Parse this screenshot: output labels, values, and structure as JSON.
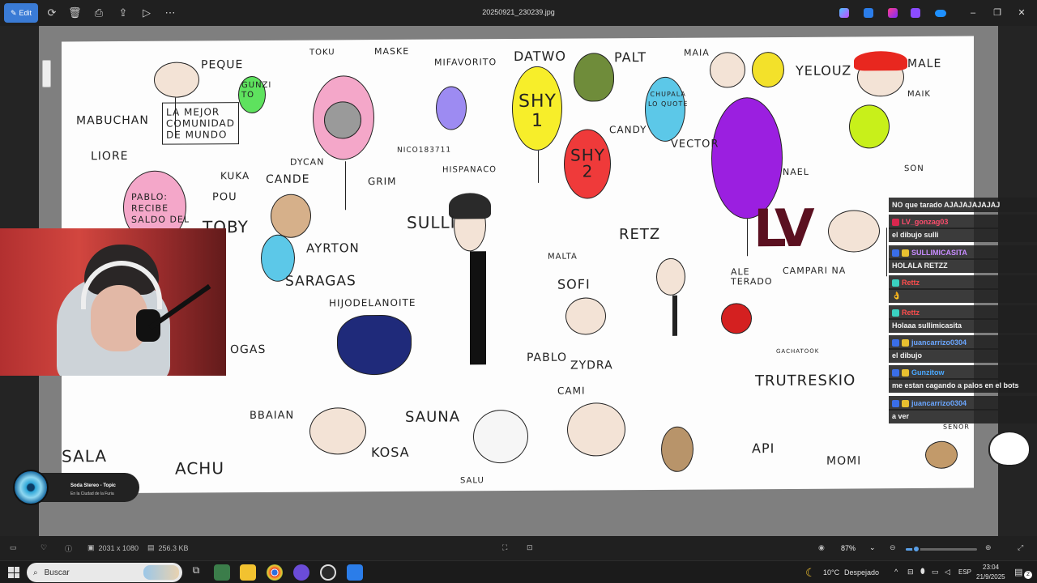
{
  "titlebar": {
    "edit_label": "Edit",
    "file_name": "20250921_230239.jpg",
    "icons": [
      "edit-icon",
      "rotate-icon",
      "delete-icon",
      "print-icon",
      "share-icon",
      "slideshow-icon",
      "more-icon"
    ],
    "window_controls": [
      "minimize-icon",
      "restore-icon",
      "close-icon"
    ]
  },
  "canvas_labels": {
    "mabuchan": "MABUCHAN",
    "peque": "PEQUE",
    "comunidad": "LA MEJOR\nCOMUNIDAD\nDE MUNDO",
    "gunzito": "GUNZI\nTO",
    "toku": "TOKU",
    "maske": "MASKE",
    "mifavorito": "MIFAVORITO",
    "datwo": "DATWO",
    "palt": "PALT",
    "maia": "MAIA",
    "yelouz": "YELOUZ",
    "male": "MALE",
    "maik": "MAIK",
    "shy1": "SHY\n1",
    "shy2": "SHY\n2",
    "chupala": "CHUPALA\nLO QUOTE",
    "candy": "CANDY",
    "vector": "VECTOR",
    "nael": "NAEL",
    "son": "SON",
    "lv": "LV",
    "liore": "LIORE",
    "pablo_balloon": "PABLO:\nRECIBE\nSALDO DEL",
    "kuka": "KUKA",
    "cande": "CANDE",
    "dycan": "DYCAN",
    "pou": "POU",
    "toby": "TOBY",
    "grim": "GRIM",
    "nico": "NICO183711",
    "hispanaco": "HISPANACO",
    "sulli": "SULLI",
    "ayrton": "AYRTON",
    "saragas": "SARAGAS",
    "hijodelanoite": "HIJODELANOITE",
    "malta": "MALTA",
    "sofi": "SOFI",
    "retz": "RETZ",
    "aleterado": "ALE\nTERADO",
    "campari": "CAMPARI NA",
    "pablo": "PABLO",
    "zydra": "ZYDRA",
    "cami": "CAMI",
    "trutreskio": "TRUTRESKIO",
    "gachatcok": "GACHATOOK",
    "api": "API",
    "momi": "MOMI",
    "senor": "SEÑOR",
    "ggas": "OGAS",
    "bbaian": "BBAIAN",
    "sala": "SALA",
    "achu": "ACHU",
    "kosa": "KOSA",
    "sauna": "SAUNA",
    "salu": "SALU"
  },
  "music": {
    "title": "Soda Stereo - Topic",
    "subtitle": "En la Ciudad de la Furia"
  },
  "chat": [
    {
      "user": "",
      "message": "NO que tarado AJAJAJAJAJAJ",
      "color": "#f2f2f2"
    },
    {
      "user": "LV_gonzag03",
      "message": "",
      "color": "#ff4d6d"
    },
    {
      "user": "",
      "message": "el dibujo sulli",
      "color": "#f2f2f2"
    },
    {
      "user": "SULLIMICASITA",
      "message": "",
      "color": "#c78bff"
    },
    {
      "user": "",
      "message": "HOLALA RETZZ",
      "color": "#f2f2f2"
    },
    {
      "user": "Rettz",
      "message": "",
      "color": "#ff4d4d"
    },
    {
      "user": "",
      "message": "👌",
      "color": "#f2f2f2"
    },
    {
      "user": "Rettz",
      "message": "",
      "color": "#ff4d4d"
    },
    {
      "user": "",
      "message": "Holaaa sullimicasita",
      "color": "#f2f2f2"
    },
    {
      "user": "juancarrizo0304",
      "message": "",
      "color": "#6aa6ff"
    },
    {
      "user": "",
      "message": "el dibujo",
      "color": "#f2f2f2"
    },
    {
      "user": "Gunzitow",
      "message": "",
      "color": "#4aa8ff"
    },
    {
      "user": "",
      "message": "me estan cagando a palos en el bots",
      "color": "#f2f2f2"
    },
    {
      "user": "juancarrizo0304",
      "message": "",
      "color": "#6aa6ff"
    },
    {
      "user": "",
      "message": "a ver",
      "color": "#f2f2f2"
    }
  ],
  "statusbar": {
    "dimensions": "2031 x 1080",
    "filesize": "256.3 KB",
    "zoom": "87%",
    "zoom_level": 0.15
  },
  "taskbar": {
    "search_placeholder": "Buscar",
    "weather": "10°C",
    "weather_desc": "Despejado",
    "language": "ESP",
    "time": "23:04",
    "date": "21/9/2025",
    "notifications": "2"
  },
  "colors": {
    "accent": "#3a7bd5",
    "balloon_pink": "#f4a7c9",
    "balloon_yellow": "#f7ee2a",
    "balloon_red": "#ef3a3a",
    "balloon_blue": "#5cc8e8",
    "balloon_purple": "#9b1fe0",
    "balloon_lime": "#c8f01a",
    "lv_color": "#5b1020"
  }
}
